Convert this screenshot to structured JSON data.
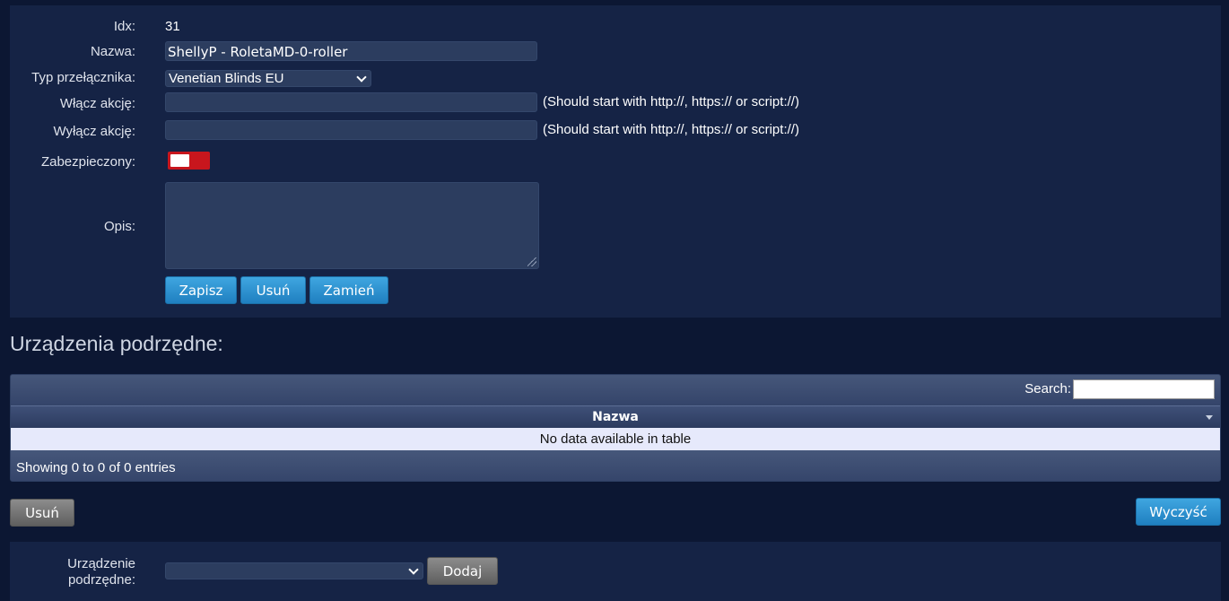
{
  "form": {
    "idx_label": "Idx:",
    "idx_value": "31",
    "name_label": "Nazwa:",
    "name_value": "ShellyP - RoletaMD-0-roller",
    "switch_type_label": "Typ przełącznika:",
    "switch_type_value": "Venetian Blinds EU",
    "on_action_label": "Włącz akcję:",
    "on_action_value": "",
    "on_action_hint": "(Should start with http://, https:// or script://)",
    "off_action_label": "Wyłącz akcję:",
    "off_action_value": "",
    "off_action_hint": "(Should start with http://, https:// or script://)",
    "protected_label": "Zabezpieczony:",
    "protected_on": false,
    "description_label": "Opis:",
    "description_value": "",
    "save_label": "Zapisz",
    "delete_label": "Usuń",
    "replace_label": "Zamień"
  },
  "subdevices": {
    "title": "Urządzenia podrzędne:",
    "search_label": "Search:",
    "column_name": "Nazwa",
    "empty_text": "No data available in table",
    "info_text": "Showing 0 to 0 of 0 entries",
    "delete_label": "Usuń",
    "clear_label": "Wyczyść"
  },
  "add_subdevice": {
    "label_line1": "Urządzenie",
    "label_line2": "podrzędne:",
    "selected_value": "",
    "add_label": "Dodaj"
  },
  "colors": {
    "page_bg": "#0c1733",
    "panel_bg": "#152345",
    "accent_blue": "#2a90d0",
    "toggle_red": "#c8161d"
  }
}
